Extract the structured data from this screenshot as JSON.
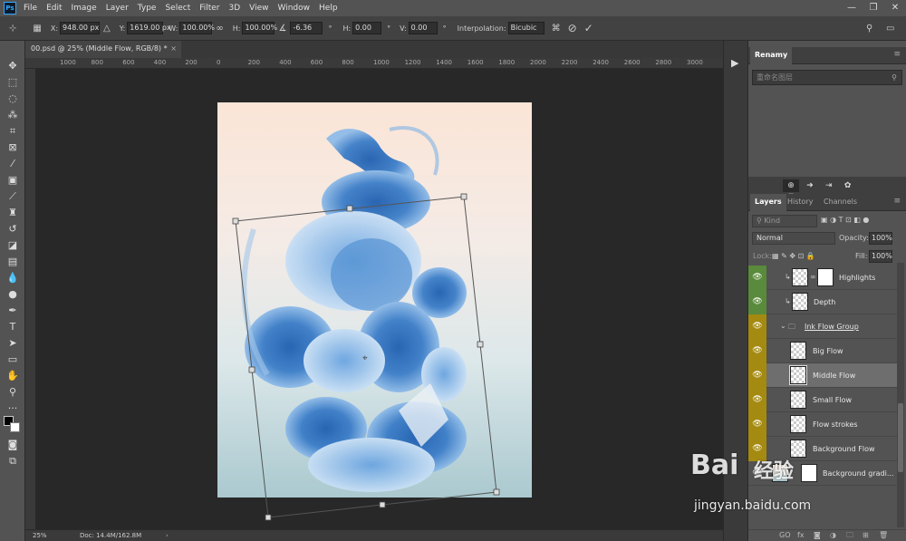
{
  "app": {
    "logo": "Ps"
  },
  "menu": [
    "File",
    "Edit",
    "Image",
    "Layer",
    "Type",
    "Select",
    "Filter",
    "3D",
    "View",
    "Window",
    "Help"
  ],
  "window_controls": [
    "—",
    "❐",
    "✕"
  ],
  "options": {
    "x_label": "X:",
    "x_value": "948.00 px",
    "y_label": "Y:",
    "y_value": "1619.00 px",
    "w_label": "W:",
    "w_value": "100.00%",
    "h_label": "H:",
    "h_value": "100.00%",
    "angle_value": "-6.36",
    "hskew_label": "H:",
    "hskew_value": "0.00",
    "vskew_label": "V:",
    "vskew_value": "0.00",
    "interp_label": "Interpolation:",
    "interp_value": "Bicubic"
  },
  "document_tab": {
    "title": "00.psd @ 25% (Middle Flow, RGB/8) *",
    "close": "×"
  },
  "ruler_top": [
    "1000",
    "800",
    "600",
    "400",
    "200",
    "0",
    "200",
    "400",
    "600",
    "800",
    "1000",
    "1200",
    "1400",
    "1600",
    "1800",
    "2000",
    "2200",
    "2400",
    "2600",
    "2800",
    "3000"
  ],
  "status": {
    "zoom": "25%",
    "doc": "Doc: 14.4M/162.8M",
    "arrow": "›"
  },
  "panels": {
    "renamy": {
      "tab": "Renamy",
      "placeholder": "重命名图层"
    },
    "tabs": [
      "Layers",
      "History",
      "Channels"
    ],
    "kind_label": "Kind",
    "blend_mode": "Normal",
    "opacity_label": "Opacity:",
    "opacity_value": "100%",
    "lock_label": "Lock:",
    "fill_label": "Fill:",
    "fill_value": "100%"
  },
  "layers": [
    {
      "name": "Highlights",
      "eye": "green"
    },
    {
      "name": "Depth",
      "eye": "green"
    },
    {
      "name": "Ink Flow Group",
      "eye": "yellow",
      "group": true
    },
    {
      "name": "Big Flow",
      "eye": "yellow"
    },
    {
      "name": "Middle Flow",
      "eye": "yellow",
      "selected": true
    },
    {
      "name": "Small Flow",
      "eye": "yellow"
    },
    {
      "name": "Flow strokes",
      "eye": "yellow"
    },
    {
      "name": "Background Flow",
      "eye": "yellow"
    },
    {
      "name": "Background gradi...",
      "eye": "none"
    }
  ],
  "layers_bottom": [
    "GO",
    "fx"
  ],
  "watermark": {
    "logo": "Bai",
    "cn": "经验",
    "url": "jingyan.baidu.com"
  },
  "colors": {
    "ink_blue": "#3b7dc8",
    "eye_green": "#5a8a3c",
    "eye_yellow": "#a48a10"
  }
}
